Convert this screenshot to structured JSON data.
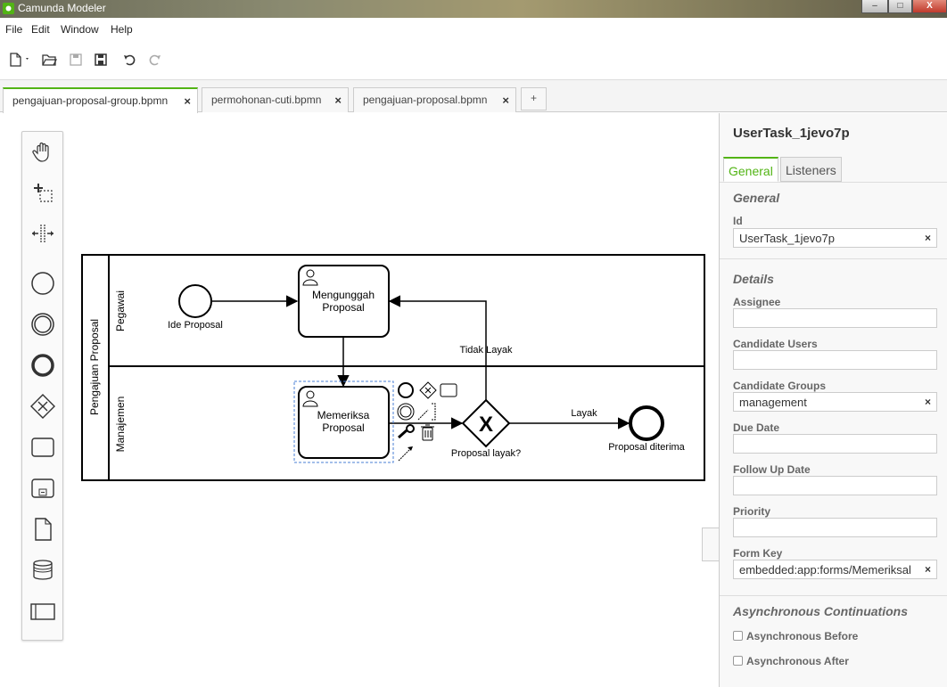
{
  "window": {
    "title": "Camunda Modeler",
    "minimize": "–",
    "maximize": "□",
    "close": "X"
  },
  "menu": [
    "File",
    "Edit",
    "Window",
    "Help"
  ],
  "tabs": [
    {
      "label": "pengajuan-proposal-group.bpmn",
      "close": "×"
    },
    {
      "label": "permohonan-cuti.bpmn",
      "close": "×"
    },
    {
      "label": "pengajuan-proposal.bpmn",
      "close": "×"
    }
  ],
  "tab_add": "+",
  "diagram": {
    "pool": "Pengajuan Proposal",
    "lanes": [
      "Pegawai",
      "Manajemen"
    ],
    "start_event": "Ide Proposal",
    "task1": [
      "Mengunggah",
      "Proposal"
    ],
    "task2": [
      "Memeriksa",
      "Proposal"
    ],
    "gateway": "Proposal layak?",
    "gateway_symbol": "X",
    "flow_reject": "Tidak Layak",
    "flow_accept": "Layak",
    "end_event": "Proposal diterima"
  },
  "properties": {
    "element_id": "UserTask_1jevo7p",
    "tabs": [
      "General",
      "Listeners"
    ],
    "group_general": "General",
    "id_label": "Id",
    "id_value": "UserTask_1jevo7p",
    "group_details": "Details",
    "assignee_label": "Assignee",
    "assignee_value": "",
    "candidate_users_label": "Candidate Users",
    "candidate_users_value": "",
    "candidate_groups_label": "Candidate Groups",
    "candidate_groups_value": "management",
    "due_date_label": "Due Date",
    "due_date_value": "",
    "follow_up_label": "Follow Up Date",
    "follow_up_value": "",
    "priority_label": "Priority",
    "priority_value": "",
    "form_key_label": "Form Key",
    "form_key_value": "embedded:app:forms/Memeriksal",
    "clear": "×",
    "group_async": "Asynchronous Continuations",
    "async_before": "Asynchronous Before",
    "async_after": "Asynchronous After"
  },
  "colors": {
    "accent": "#52b415",
    "selection": "#4a7fd6"
  }
}
